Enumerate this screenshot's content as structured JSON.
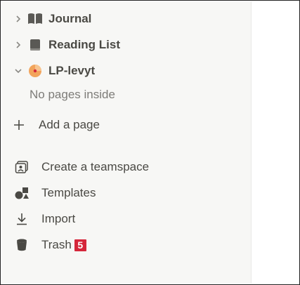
{
  "sidebar": {
    "pages": [
      {
        "label": "Journal",
        "icon": "open-book-icon",
        "chevron": "right"
      },
      {
        "label": "Reading List",
        "icon": "closed-book-icon",
        "chevron": "right"
      },
      {
        "label": "LP-levyt",
        "icon": "vinyl-record-icon",
        "chevron": "down"
      }
    ],
    "empty_note": "No pages inside",
    "add_page_label": "Add a page",
    "utilities": [
      {
        "label": "Create a teamspace",
        "icon": "teamspace-icon"
      },
      {
        "label": "Templates",
        "icon": "templates-icon"
      },
      {
        "label": "Import",
        "icon": "import-icon"
      },
      {
        "label": "Trash",
        "icon": "trash-icon",
        "badge": "5"
      }
    ]
  },
  "colors": {
    "sidebar_bg": "#f7f7f5",
    "text": "#4a4944",
    "muted": "#7d7c78",
    "badge": "#d5263a",
    "record": "#f2a45b"
  }
}
